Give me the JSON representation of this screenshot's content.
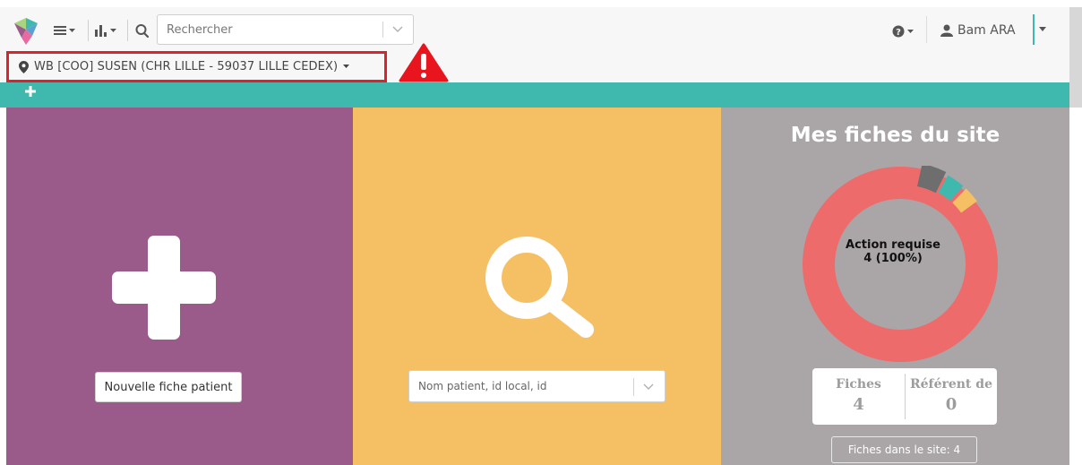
{
  "header": {
    "search": {
      "placeholder": "Rechercher"
    },
    "user": {
      "name": "Bam ARA"
    },
    "site_selector": {
      "label": "WB [COO] SUSEN (CHR LILLE - 59037 LILLE CEDEX)"
    }
  },
  "panels": {
    "new_patient": {
      "button_label": "Nouvelle fiche patient"
    },
    "search_patient": {
      "placeholder": "Nom patient, id local, id"
    },
    "site_stats": {
      "title": "Mes fiches du site",
      "center_label": "Action requise",
      "center_value": "4 (100%)",
      "fiches_label": "Fiches",
      "fiches_value": "4",
      "referent_label": "Référent de",
      "referent_value": "0",
      "site_count_label": "Fiches dans le site: 4"
    }
  },
  "chart_data": {
    "type": "pie",
    "slices": [
      {
        "label": "Action requise",
        "value": 4,
        "percent": 100,
        "color": "#ee6b6b"
      },
      {
        "label": "",
        "value": 0,
        "color": "#6e6e6e"
      },
      {
        "label": "",
        "value": 0,
        "color": "#3fb9ad"
      },
      {
        "label": "",
        "value": 0,
        "color": "#f5bf64"
      }
    ]
  },
  "colors": {
    "accent_teal": "#3fb9ad",
    "panel_purple": "#9a5b8b",
    "panel_yellow": "#f5bf64",
    "panel_grey": "#aaa6a8",
    "alert_red": "#d9232d"
  },
  "icons": [
    "app-logo-icon",
    "menu-icon",
    "stats-icon",
    "search-icon",
    "help-icon",
    "user-icon",
    "map-pin-icon",
    "warning-icon",
    "plus-icon",
    "magnifier-icon"
  ]
}
